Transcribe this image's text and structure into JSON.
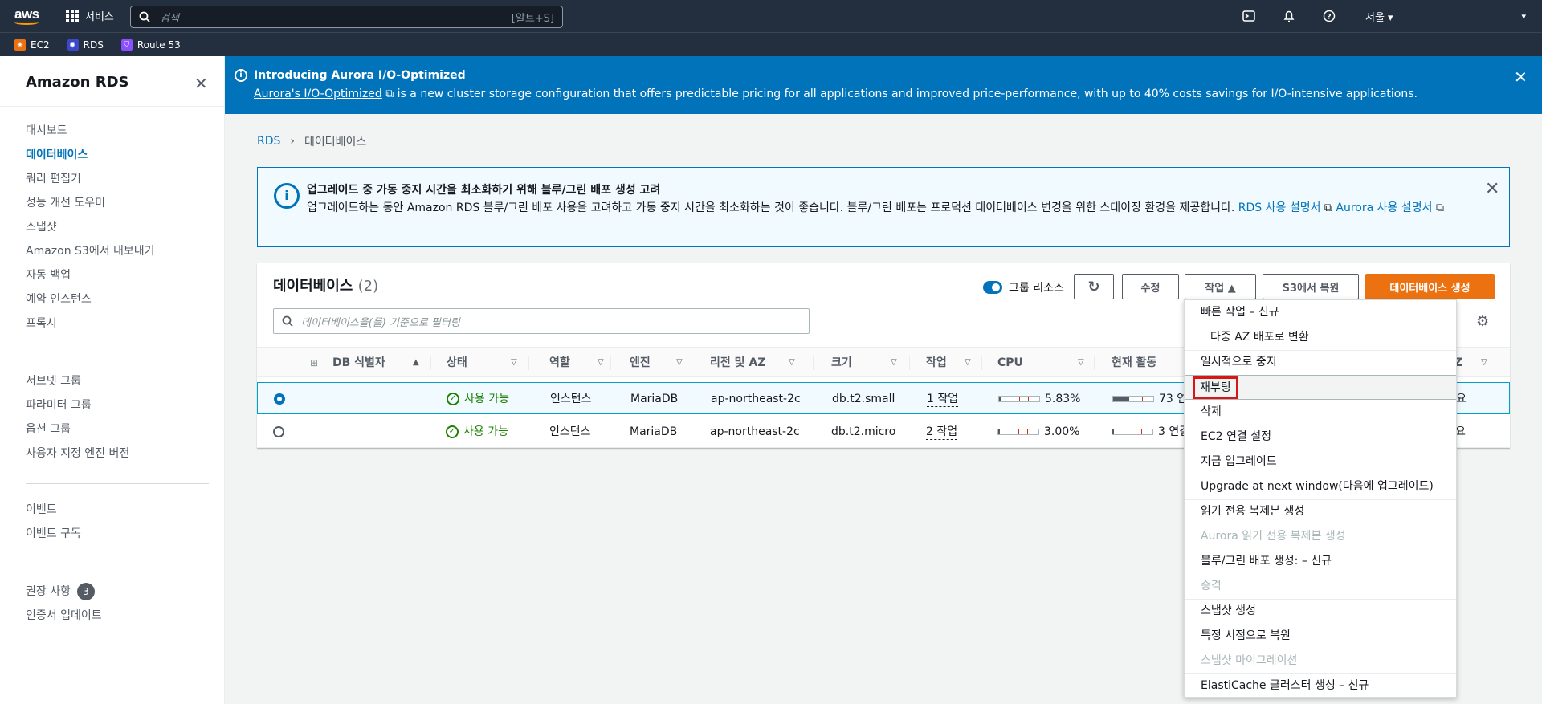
{
  "topnav": {
    "logo": "aws",
    "services_label": "서비스",
    "search_placeholder": "검색",
    "search_shortcut": "[알트+S]",
    "region": "서울 ▾",
    "account": "▾"
  },
  "favorites": [
    {
      "label": "EC2",
      "color": "#ec7211",
      "icon": "ec2-icon"
    },
    {
      "label": "RDS",
      "color": "#3b48cc",
      "icon": "rds-icon"
    },
    {
      "label": "Route 53",
      "color": "#8c4fff",
      "icon": "route53-icon"
    }
  ],
  "sidebar": {
    "title": "Amazon RDS",
    "group1": [
      "대시보드",
      "데이터베이스",
      "쿼리 편집기",
      "성능 개선 도우미",
      "스냅샷",
      "Amazon S3에서 내보내기",
      "자동 백업",
      "예약 인스턴스",
      "프록시"
    ],
    "group2": [
      "서브넷 그룹",
      "파라미터 그룹",
      "옵션 그룹",
      "사용자 지정 엔진 버전"
    ],
    "group3": [
      "이벤트",
      "이벤트 구독"
    ],
    "group4_item1": "권장 사항",
    "group4_badge": "3",
    "group4_item2": "인증서 업데이트"
  },
  "aurora_banner": {
    "title": "Introducing Aurora I/O-Optimized",
    "link": "Aurora's I/O-Optimized",
    "text": " is a new cluster storage configuration that offers predictable pricing for all applications and improved price-performance, with up to 40% costs savings for I/O-intensive applications."
  },
  "breadcrumb": {
    "root": "RDS",
    "current": "데이터베이스"
  },
  "alert": {
    "title": "업그레이드 중 가동 중지 시간을 최소화하기 위해 블루/그린 배포 생성 고려",
    "text": "업그레이드하는 동안 Amazon RDS 블루/그린 배포 사용을 고려하고 가동 중지 시간을 최소화하는 것이 좋습니다. 블루/그린 배포는 프로덕션 데이터베이스 변경을 위한 스테이징 환경을 제공합니다. ",
    "link1": "RDS 사용 설명서",
    "link2": "Aurora 사용 설명서"
  },
  "panel": {
    "title": "데이터베이스",
    "count": "(2)",
    "group_resources": "그룹 리소스",
    "btn_modify": "수정",
    "btn_actions": "작업 ▲",
    "btn_restore": "S3에서 복원",
    "btn_create": "데이터베이스 생성",
    "filter_placeholder": "데이터베이스을(를) 기준으로 필터링"
  },
  "columns": [
    "DB 식별자",
    "상태",
    "역할",
    "엔진",
    "리전 및 AZ",
    "크기",
    "작업",
    "CPU",
    "현재 활동",
    "AZ"
  ],
  "rows": [
    {
      "id": "",
      "status": "사용 가능",
      "role": "인스턴스",
      "engine": "MariaDB",
      "region": "ap-northeast-2c",
      "size": "db.t2.small",
      "actions": "1 작업",
      "cpu": "5.83%",
      "cpu_pct": 5.83,
      "activity": "73 연결",
      "activity_pct": 40,
      "az": "요",
      "selected": true
    },
    {
      "id": "",
      "status": "사용 가능",
      "role": "인스턴스",
      "engine": "MariaDB",
      "region": "ap-northeast-2c",
      "size": "db.t2.micro",
      "actions": "2 작업",
      "cpu": "3.00%",
      "cpu_pct": 3.0,
      "activity": "3 연결",
      "activity_pct": 3,
      "az": "요",
      "selected": false
    }
  ],
  "dropdown": [
    {
      "label": "빠른 작업 – 신규",
      "type": "normal"
    },
    {
      "label": "다중 AZ 배포로 변환",
      "type": "sub"
    },
    {
      "label": "일시적으로 중지",
      "type": "normal"
    },
    {
      "label": "재부팅",
      "type": "highlight"
    },
    {
      "label": "삭제",
      "type": "normal"
    },
    {
      "label": "EC2 연결 설정",
      "type": "normal"
    },
    {
      "label": "지금 업그레이드",
      "type": "normal"
    },
    {
      "label": "Upgrade at next window(다음에 업그레이드)",
      "type": "normal"
    },
    {
      "label": "읽기 전용 복제본 생성",
      "type": "normal"
    },
    {
      "label": "Aurora 읽기 전용 복제본 생성",
      "type": "disabled"
    },
    {
      "label": "블루/그린 배포 생성: – 신규",
      "type": "normal"
    },
    {
      "label": "승격",
      "type": "disabled"
    },
    {
      "label": "스냅샷 생성",
      "type": "normal"
    },
    {
      "label": "특정 시점으로 복원",
      "type": "normal"
    },
    {
      "label": "스냅샷 마이그레이션",
      "type": "disabled"
    },
    {
      "label": "ElastiCache 클러스터 생성 – 신규",
      "type": "normal"
    }
  ]
}
